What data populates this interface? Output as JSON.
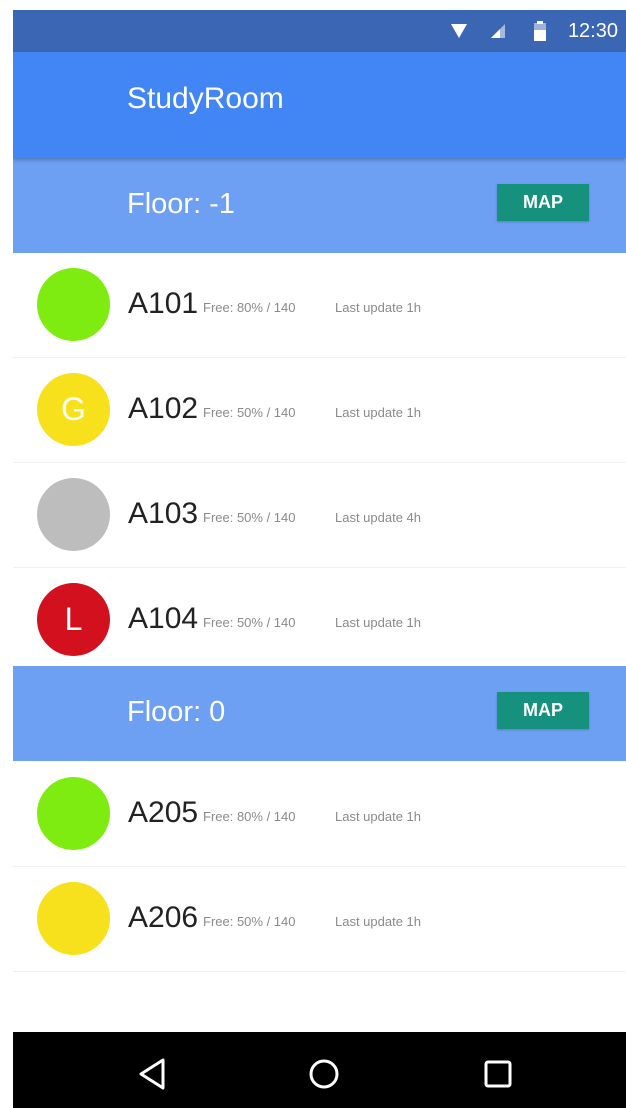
{
  "status_bar": {
    "time": "12:30",
    "icons": [
      "wifi-icon",
      "signal-icon",
      "battery-icon"
    ]
  },
  "app_bar": {
    "title": "StudyRoom"
  },
  "floors": [
    {
      "title": "Floor: -1",
      "map_label": "MAP",
      "rooms": [
        {
          "letter": "",
          "color": "#7eec10",
          "name": "A101",
          "free": "Free: 80% / 140",
          "update": "Last update 1h"
        },
        {
          "letter": "G",
          "color": "#f7e11d",
          "name": "A102",
          "free": "Free: 50% / 140",
          "update": "Last update 1h"
        },
        {
          "letter": "",
          "color": "#bdbdbd",
          "name": "A103",
          "free": "Free: 50% / 140",
          "update": "Last update 4h"
        },
        {
          "letter": "L",
          "color": "#d3101e",
          "name": "A104",
          "free": "Free: 50% / 140",
          "update": "Last update 1h"
        }
      ]
    },
    {
      "title": "Floor: 0",
      "map_label": "MAP",
      "rooms": [
        {
          "letter": "",
          "color": "#7eec10",
          "name": "A205",
          "free": "Free: 80% / 140",
          "update": "Last update 1h"
        },
        {
          "letter": "",
          "color": "#f7e11d",
          "name": "A206",
          "free": "Free: 50% / 140",
          "update": "Last update 1h"
        }
      ]
    }
  ],
  "nav_bar": {
    "buttons": [
      "back-icon",
      "home-icon",
      "recents-icon"
    ]
  },
  "colors": {
    "status_bar": "#3a66b4",
    "app_bar": "#4285f4",
    "floor_header": "#6d9ff2",
    "map_button": "#16917e"
  }
}
